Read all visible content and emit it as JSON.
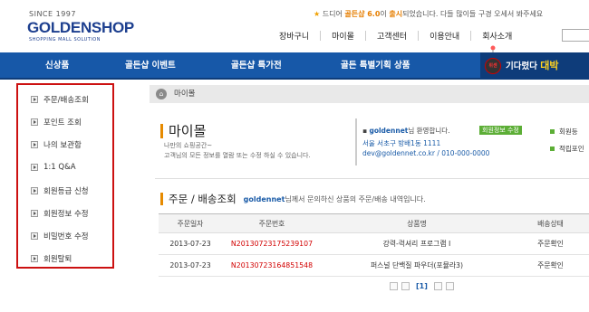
{
  "brand": {
    "since": "SINCE 1997",
    "logo": "GOLDENSHOP",
    "tagline": "SHOPPING MALL SOLUTION"
  },
  "notice": {
    "prefix": "드디어",
    "highlight": "골든샵 6.0",
    "middle": "이",
    "highlight2": "출시",
    "suffix": "되었습니다. 다들 많이들 구경 오세서 봐주세요"
  },
  "topnav": [
    "장바구니",
    "마이몰",
    "고객센터",
    "이용안내",
    "회사소개"
  ],
  "menu": [
    "신상품",
    "골든샵 이벤트",
    "골든샵 특가전",
    "골든 특별기획 상품"
  ],
  "promo": {
    "badge": "휘센",
    "text": "기다렸다",
    "highlight": "대박"
  },
  "sidebar": [
    "주문/배송조회",
    "포인트 조회",
    "나의 보관함",
    "1:1 Q&A",
    "회원등급 신청",
    "회원정보 수정",
    "비밀번호 수정",
    "회원탈퇴"
  ],
  "breadcrumb": {
    "label": "마이몰"
  },
  "mypage": {
    "title": "마이몰",
    "desc1": "나만의 쇼핑공간~",
    "desc2": "고객님의 모든 정보를 열람 또는 수정 하실 수 있습니다."
  },
  "welcome": {
    "user": "goldennet",
    "greet": "님 환영합니다.",
    "edit_button": "회원정보 수정",
    "address": "서울 서초구 방배1동 1111",
    "contact": "dev@goldennet.co.kr / 010-000-0000"
  },
  "rightlinks": [
    "회원등",
    "적립포인"
  ],
  "orders": {
    "title": "주문 / 배송조회",
    "user": "goldennet",
    "desc": "님께서 문의하신 상품의 주문/배송 내역입니다.",
    "headers": [
      "주문일자",
      "주문번호",
      "상품명",
      "배송상태"
    ],
    "rows": [
      {
        "date": "2013-07-23",
        "no": "N20130723175239107",
        "name": "강력-럭셔리 프로그램 I",
        "status": "주문확인"
      },
      {
        "date": "2013-07-23",
        "no": "N20130723164851548",
        "name": "퍼스널 단백질 파우더(포뮬라3)",
        "status": "주문확인"
      }
    ]
  },
  "pager": {
    "current": "[1]"
  }
}
